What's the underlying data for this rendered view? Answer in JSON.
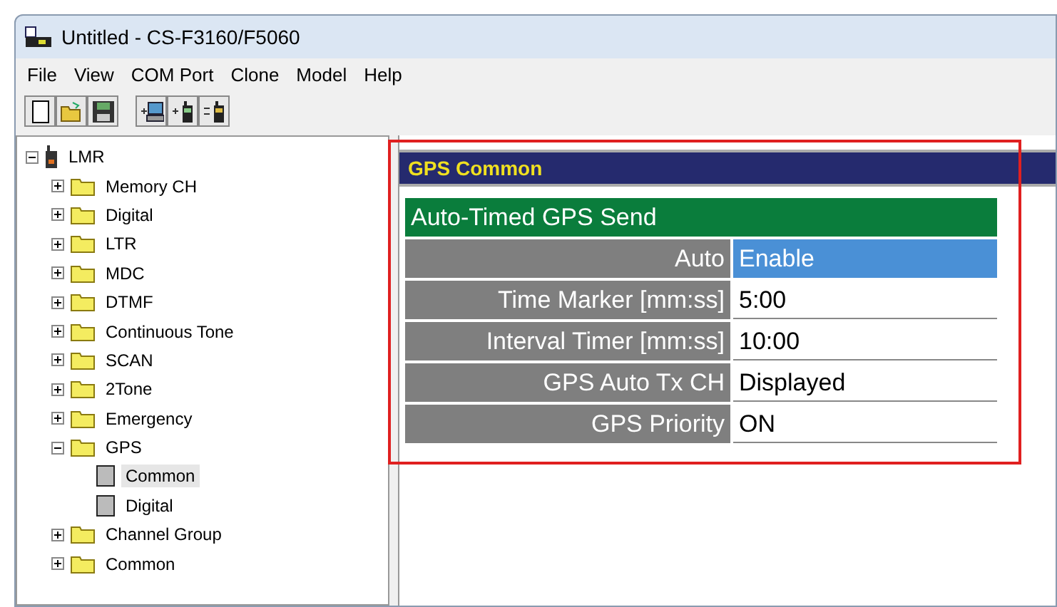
{
  "window": {
    "title": "Untitled - CS-F3160/F5060"
  },
  "menu": [
    "File",
    "View",
    "COM Port",
    "Clone",
    "Model",
    "Help"
  ],
  "toolbar": [
    {
      "kind": "new"
    },
    {
      "kind": "open"
    },
    {
      "kind": "save"
    },
    {
      "kind": "sep"
    },
    {
      "kind": "pc"
    },
    {
      "kind": "radio"
    },
    {
      "kind": "swap"
    }
  ],
  "tree": [
    {
      "label": "LMR",
      "kind": "radio",
      "expanded": true,
      "selected": false,
      "children": [
        {
          "label": "Memory CH",
          "kind": "folder",
          "expanded": false,
          "selected": false
        },
        {
          "label": "Digital",
          "kind": "folder",
          "expanded": false,
          "selected": false
        },
        {
          "label": "LTR",
          "kind": "folder",
          "expanded": false,
          "selected": false
        },
        {
          "label": "MDC",
          "kind": "folder",
          "expanded": false,
          "selected": false
        },
        {
          "label": "DTMF",
          "kind": "folder",
          "expanded": false,
          "selected": false
        },
        {
          "label": "Continuous Tone",
          "kind": "folder",
          "expanded": false,
          "selected": false
        },
        {
          "label": "SCAN",
          "kind": "folder",
          "expanded": false,
          "selected": false
        },
        {
          "label": "2Tone",
          "kind": "folder",
          "expanded": false,
          "selected": false
        },
        {
          "label": "Emergency",
          "kind": "folder",
          "expanded": false,
          "selected": false
        },
        {
          "label": "GPS",
          "kind": "folder",
          "expanded": true,
          "selected": false,
          "children": [
            {
              "label": "Common",
              "kind": "page",
              "selected": true
            },
            {
              "label": "Digital",
              "kind": "page",
              "selected": false
            }
          ]
        },
        {
          "label": "Channel Group",
          "kind": "folder",
          "expanded": false,
          "selected": false
        },
        {
          "label": "Common",
          "kind": "folder",
          "expanded": false,
          "selected": false
        }
      ]
    }
  ],
  "panel": {
    "title": "GPS Common",
    "group": "Auto-Timed GPS Send",
    "rows": [
      {
        "label": "Auto",
        "value": "Enable",
        "selected": true
      },
      {
        "label": "Time Marker [mm:ss]",
        "value": "5:00",
        "selected": false
      },
      {
        "label": "Interval Timer [mm:ss]",
        "value": "10:00",
        "selected": false
      },
      {
        "label": "GPS Auto Tx CH",
        "value": "Displayed",
        "selected": false
      },
      {
        "label": "GPS Priority",
        "value": "ON",
        "selected": false
      }
    ]
  }
}
